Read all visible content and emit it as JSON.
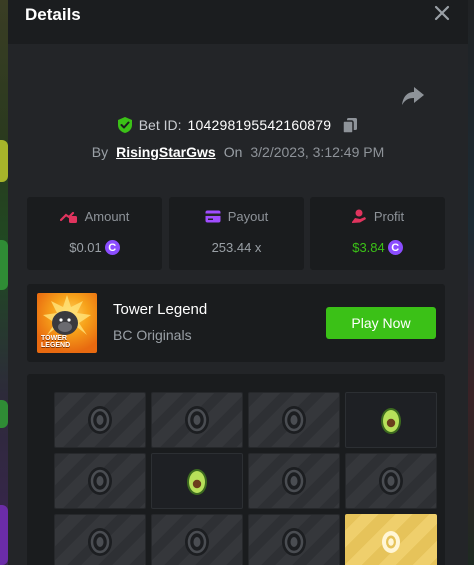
{
  "modal": {
    "title": "Details"
  },
  "bet": {
    "id_label": "Bet ID:",
    "id_value": "104298195542160879",
    "by_label": "By",
    "username": "RisingStarGws",
    "on_label": "On",
    "date": "3/2/2023, 3:12:49 PM"
  },
  "stats": {
    "amount": {
      "label": "Amount",
      "value": "$0.01",
      "coin": "C"
    },
    "payout": {
      "label": "Payout",
      "value": "253.44 x"
    },
    "profit": {
      "label": "Profit",
      "value": "$3.84",
      "coin": "C"
    }
  },
  "game": {
    "thumb_line1": "TOWER",
    "thumb_line2": "LEGEND",
    "name": "Tower Legend",
    "provider": "BC Originals",
    "play_label": "Play Now"
  },
  "board": {
    "rows": [
      [
        "closed",
        "closed",
        "closed",
        "avocado"
      ],
      [
        "closed",
        "avocado",
        "closed",
        "closed"
      ],
      [
        "closed",
        "closed",
        "closed",
        "gold"
      ]
    ]
  },
  "colors": {
    "accent_green": "#3bc117",
    "coin_purple": "#8b4dff",
    "icon_pink": "#e0345e",
    "gold_tile": "#e6c35a"
  }
}
